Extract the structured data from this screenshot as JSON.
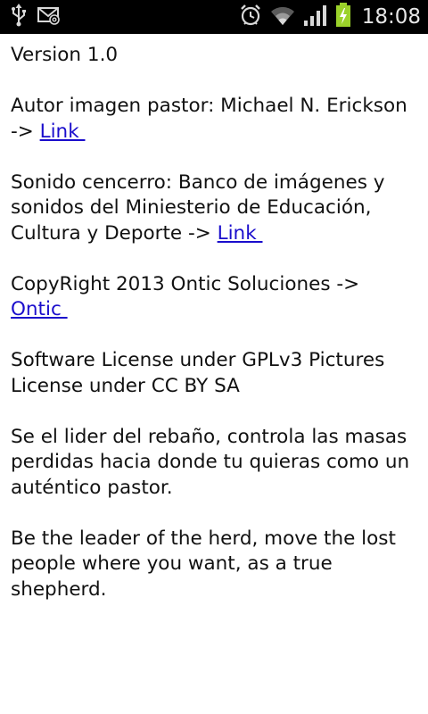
{
  "status_bar": {
    "time": "18:08",
    "icons": [
      "usb-icon",
      "mail-icon",
      "alarm-icon",
      "wifi-icon",
      "signal-icon",
      "battery-charging-icon"
    ]
  },
  "content": {
    "version": "Version 1.0",
    "author": {
      "text": "Autor imagen pastor: Michael N. Erickson",
      "arrow": "-> ",
      "link": "Link "
    },
    "sound": {
      "text": "Sonido cencerro: Banco de imágenes y sonidos del Miniesterio de Educación, Cultura y Deporte -> ",
      "link": "Link "
    },
    "copyright": {
      "text": "CopyRight 2013 Ontic Soluciones -> ",
      "link": "Ontic "
    },
    "license": "Software License under GPLv3 Pictures License under CC BY SA",
    "desc_es": "Se el lider del rebaño, controla las masas perdidas hacia donde tu quieras como un auténtico pastor.",
    "desc_en": "Be the leader of the herd, move the lost people where you want, as a true shepherd."
  }
}
